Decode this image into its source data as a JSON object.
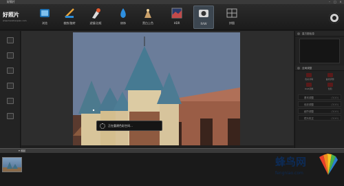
{
  "window": {
    "title": "好照片"
  },
  "logo": {
    "name": "好照片",
    "sub": "www.haozhaopian.com"
  },
  "toolbar": {
    "items": [
      {
        "label": "浏览",
        "icon": "browse-icon"
      },
      {
        "label": "裁剪/旋转",
        "icon": "crop-icon"
      },
      {
        "label": "滤镜/边框",
        "icon": "filter-icon"
      },
      {
        "label": "修饰",
        "icon": "retouch-icon"
      },
      {
        "label": "黑白上色",
        "icon": "colorize-icon"
      },
      {
        "label": "HDR",
        "icon": "hdr-icon"
      },
      {
        "label": "RAW",
        "icon": "raw-icon"
      },
      {
        "label": "拼图",
        "icon": "collage-icon"
      }
    ],
    "active": "RAW"
  },
  "status": {
    "message": "正在重建色彩空间…"
  },
  "panel": {
    "sections": [
      "直方图信息",
      "全局调整"
    ],
    "tools": [
      "色彩清晰",
      "曲线调整",
      "RGB调整",
      "色阶"
    ],
    "rows": [
      {
        "label": "基本调整",
        "count": "(3/10)"
      },
      {
        "label": "色彩调整",
        "count": "(3/10)"
      },
      {
        "label": "细节调整",
        "count": "(3/10)"
      },
      {
        "label": "镜头校正",
        "count": "(3/10)"
      }
    ]
  },
  "filmstrip": {
    "toggle_label": "收起"
  },
  "watermark": {
    "cn": "蜂鸟网",
    "en": "fengniao.com"
  }
}
